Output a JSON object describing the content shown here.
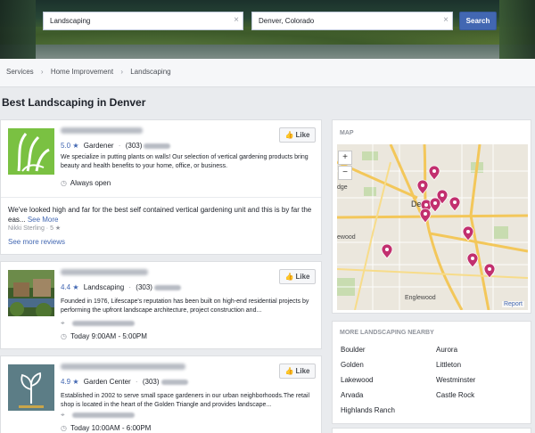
{
  "search": {
    "what_value": "Landscaping",
    "where_value": "Denver, Colorado",
    "button_label": "Search"
  },
  "breadcrumb": [
    "Services",
    "Home Improvement",
    "Landscaping"
  ],
  "page_title": "Best Landscaping in Denver",
  "listings": [
    {
      "rating": "5.0",
      "category": "Gardener",
      "phone_prefix": "(303)",
      "description": "We specialize in putting plants on walls! Our selection of vertical gardening products bring beauty and health benefits to your home, office, or business.",
      "hours": "Always open",
      "like_label": "Like",
      "review_text": "We've looked high and far for the best self contained vertical gardening unit and this is by far the eas...",
      "review_more": "See More",
      "review_author": "Nikki Sterling",
      "review_stars": "5 ★",
      "see_more_reviews": "See more reviews"
    },
    {
      "rating": "4.4",
      "category": "Landscaping",
      "phone_prefix": "(303)",
      "description": "Founded in 1976, Lifescape's reputation has been built on high-end residential projects by performing the upfront landscape architecture, project construction and...",
      "hours": "Today 9:00AM - 5:00PM",
      "like_label": "Like"
    },
    {
      "rating": "4.9",
      "category": "Garden Center",
      "phone_prefix": "(303)",
      "description": "Established in 2002 to serve small space gardeners in our urban neighborhoods.The retail shop is located in the heart of the Golden Triangle and provides landscape...",
      "hours": "Today 10:00AM - 6:00PM",
      "like_label": "Like"
    }
  ],
  "map": {
    "header": "MAP",
    "zoom_in": "+",
    "zoom_out": "−",
    "labels": {
      "denver": "Denver",
      "lakewood": "ewood",
      "englewood": "Englewood",
      "edge": "dge"
    },
    "report": "Report",
    "pin_color": "#c2306f"
  },
  "nearby": {
    "header": "MORE LANDSCAPING NEARBY",
    "cities": [
      "Boulder",
      "Aurora",
      "Golden",
      "Littleton",
      "Lakewood",
      "Westminster",
      "Arvada",
      "Castle Rock",
      "Highlands Ranch"
    ]
  },
  "colors": {
    "accent": "#4267b2",
    "pin": "#c2306f"
  }
}
